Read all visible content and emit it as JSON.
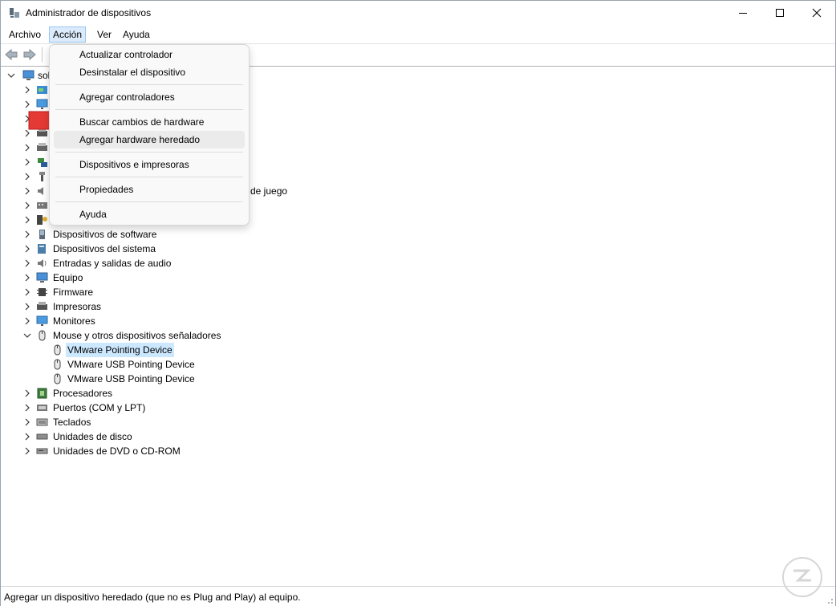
{
  "window": {
    "title": "Administrador de dispositivos"
  },
  "menu": [
    "Archivo",
    "Acción",
    "Ver",
    "Ayuda"
  ],
  "tree": {
    "root_label": "sol",
    "partial_label": "de juego",
    "items": [
      "Dispositivos de software",
      "Dispositivos del sistema",
      "Entradas y salidas de audio",
      "Equipo",
      "Firmware",
      "Impresoras",
      "Monitores",
      "Mouse y otros dispositivos señaladores",
      "VMware Pointing Device",
      "VMware USB Pointing Device",
      "VMware USB Pointing Device",
      "Procesadores",
      "Puertos (COM y LPT)",
      "Teclados",
      "Unidades de disco",
      "Unidades de DVD o CD-ROM"
    ]
  },
  "context_menu": [
    "Actualizar controlador",
    "Desinstalar el dispositivo",
    "Agregar controladores",
    "Buscar cambios de hardware",
    "Agregar hardware heredado",
    "Dispositivos e impresoras",
    "Propiedades",
    "Ayuda"
  ],
  "status_bar": {
    "text": "Agregar un dispositivo heredado (que no es Plug and Play) al equipo."
  },
  "colors": {
    "selection": "#cce8ff",
    "menu_active": "#dcebfb",
    "annotation_arrow": "#e53935"
  },
  "icons": [
    "device-manager-icon",
    "back-arrow-icon",
    "forward-arrow-icon",
    "minimize-icon",
    "maximize-icon",
    "close-icon",
    "mouse-icon",
    "chevron-right-icon",
    "chevron-down-icon"
  ]
}
